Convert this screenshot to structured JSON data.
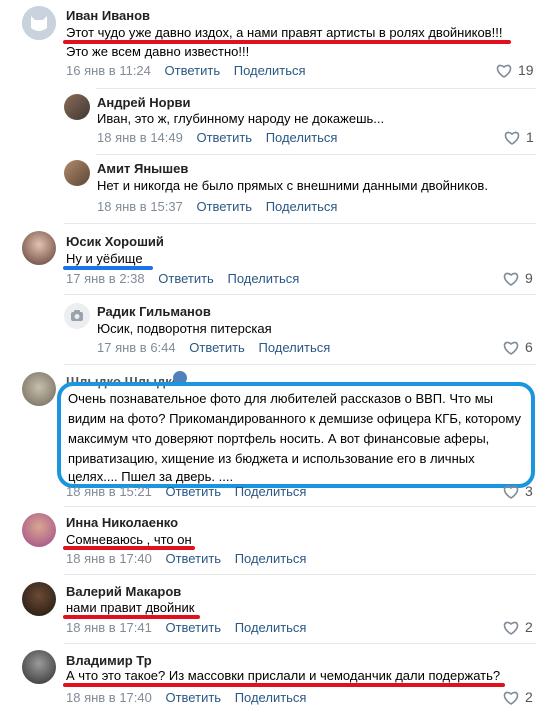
{
  "actions": {
    "reply": "Ответить",
    "share": "Поделиться"
  },
  "c1": {
    "author": "Иван Иванов",
    "line1": "Этот чудо уже давно издох, а нами правят артисты в ролях двойников!!!",
    "line2": "Это же всем давно известно!!!",
    "date": "16 янв в 11:24",
    "likes": "19"
  },
  "c2": {
    "author": "Андрей Норви",
    "text": "Иван, это ж, глубинному народу не докажешь...",
    "date": "18 янв в 14:49",
    "likes": "1"
  },
  "c3": {
    "author": "Амит Янышев",
    "text": "Нет и никогда не было прямых с внешними данными двойников.",
    "date": "18 янв в 15:37",
    "likes": ""
  },
  "c4": {
    "author": "Юсик Хороший",
    "text": "Ну и уёбище",
    "date": "17 янв в 2:38",
    "likes": "9"
  },
  "c5": {
    "author": "Радик Гильманов",
    "text": "Юсик, подворотня питерская",
    "date": "17 янв в 6:44",
    "likes": "6"
  },
  "c6": {
    "author": "Шлыдко Шлыдко",
    "line1": "Очень познавательное фото для любителей рассказов о ВВП. Что мы",
    "line2": "видим на фото? Прикомандированного к демшизе офицера КГБ, которому",
    "line3": "максимум что доверяют портфель носить. А вот финансовые аферы,",
    "line4": "приватизацию, хищение из бюджета и использование его в личных",
    "line5": "целях.... Пшел за дверь. ....",
    "date": "18 янв в 15:21",
    "likes": "3"
  },
  "c7": {
    "author": "Инна Николаенко",
    "text": "Сомневаюсь , что он",
    "date": "18 янв в 17:40",
    "likes": ""
  },
  "c8": {
    "author": "Валерий Макаров",
    "text": "нами правит двойник",
    "date": "18 янв в 17:41",
    "likes": "2"
  },
  "c9": {
    "author": "Владимир Тр",
    "text": "А что это такое? Из массовки прислали и чемоданчик дали подержать?",
    "date": "18 янв в 17:40",
    "likes": "2"
  },
  "colors": {
    "link": "#2a5885",
    "meta": "#818c99",
    "red_mark": "#e0101c",
    "blue_mark": "#1a95e0"
  }
}
